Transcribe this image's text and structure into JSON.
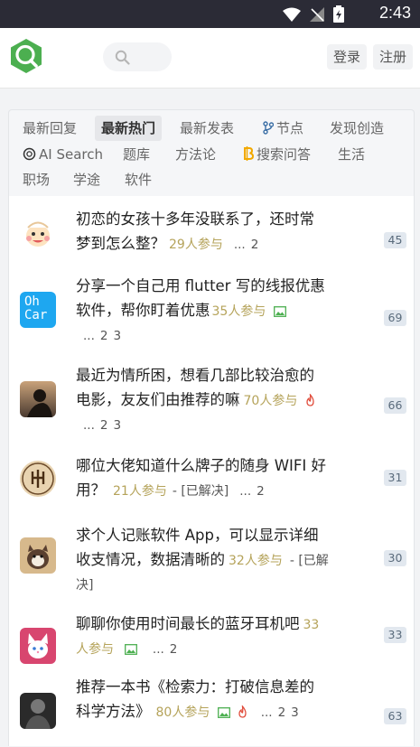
{
  "status_bar": {
    "time": "2:43"
  },
  "header": {
    "login": "登录",
    "register": "注册"
  },
  "tabs": [
    {
      "label": "最新回复"
    },
    {
      "label": "最新热门",
      "active": true
    },
    {
      "label": "最新发表"
    },
    {
      "label": "节点",
      "icon": "node-icon"
    },
    {
      "label": "发现创造"
    },
    {
      "label": "AI Search",
      "icon": "openai-icon"
    },
    {
      "label": "题库"
    },
    {
      "label": "方法论"
    },
    {
      "label": "搜索问答",
      "icon": "bitcoin-icon"
    },
    {
      "label": "生活"
    },
    {
      "label": "职场"
    },
    {
      "label": "学途"
    },
    {
      "label": "软件"
    }
  ],
  "topics": [
    {
      "line1": "初恋的女孩十多年没联系了，还时常",
      "line2": "梦到怎么整？",
      "participants": "29人参与",
      "extra": "",
      "pages": [
        "...",
        "2"
      ],
      "replies": "45"
    },
    {
      "line1": "分享一个自己用 flutter 写的线报优惠",
      "line2": "软件，帮你盯着优惠",
      "participants": "35人参与",
      "extra": "",
      "pages": [
        "...",
        "2",
        "3"
      ],
      "replies": "69"
    },
    {
      "line1": "最近为情所困，想看几部比较治愈的",
      "line2": "电影，友友们由推荐的嘛",
      "participants": "70人参与",
      "extra": "",
      "pages": [
        "...",
        "2",
        "3"
      ],
      "replies": "66"
    },
    {
      "line1": "哪位大佬知道什么牌子的随身 WIFI 好",
      "line2": "用？",
      "participants": "21人参与",
      "extra": "- [已解决]",
      "pages": [
        "...",
        "2"
      ],
      "replies": "31"
    },
    {
      "line1": "求个人记账软件 App，可以显示详细",
      "line2": "收支情况，数据清晰的",
      "participants": "32人参与",
      "extra": "- [已解",
      "extra2": "决]",
      "pages": [],
      "replies": "30"
    },
    {
      "line1": "聊聊你使用时间最长的蓝牙耳机吧",
      "line1b": "33",
      "line2": "人参与",
      "participants": "",
      "extra": "",
      "pages": [
        "...",
        "2"
      ],
      "replies": "33"
    },
    {
      "line1": "推荐一本书《检索力：打破信息差的",
      "line2": "科学方法》",
      "participants": "80人参与",
      "extra": "",
      "pages": [
        "...",
        "2",
        "3"
      ],
      "replies": "63"
    }
  ],
  "avatar_texts": {
    "ohcar_line1": "Oh",
    "ohcar_line2": "Car"
  },
  "colors": {
    "accent": "#4caf50",
    "participants": "#b5a35a",
    "badge_bg": "#e2e8ef"
  }
}
